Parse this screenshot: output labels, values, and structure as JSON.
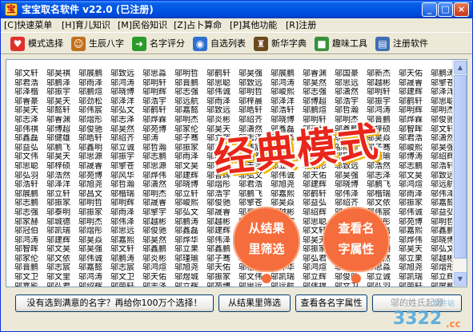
{
  "window": {
    "title": "宝宝取名软件 v22.0 (已注册)",
    "minimize_glyph": "_",
    "maximize_glyph": "□",
    "close_glyph": "×"
  },
  "menu": {
    "items": [
      {
        "label": "[C]快速菜单"
      },
      {
        "label": "[H]育儿知识"
      },
      {
        "label": "[M]民俗知识"
      },
      {
        "label": "[Z]占卜算命"
      },
      {
        "label": "[P]其他功能"
      },
      {
        "label": "[R]注册"
      }
    ]
  },
  "toolbar": {
    "items": [
      {
        "label": "模式选择",
        "icon": "heart-icon",
        "glyph": "♥",
        "color": "#e0302a"
      },
      {
        "label": "生辰八字",
        "icon": "people-icon",
        "glyph": "☺",
        "color": "#c0701a"
      },
      {
        "label": "名字评分",
        "icon": "arrow-right-icon",
        "glyph": "➜",
        "color": "#2a9a2a"
      },
      {
        "label": "自选列表",
        "icon": "globe-icon",
        "glyph": "◉",
        "color": "#2f6fd0"
      },
      {
        "label": "新华字典",
        "icon": "scholar-icon",
        "glyph": "♜",
        "color": "#6b4a1e"
      },
      {
        "label": "趣味工具",
        "icon": "windows-icon",
        "glyph": "■",
        "color": "#3a8f3a"
      },
      {
        "label": "注册软件",
        "icon": "register-icon",
        "glyph": "▤",
        "color": "#3f6fb5"
      }
    ]
  },
  "names": {
    "columns": [
      [
        "邬文轩",
        "邬君浩",
        "邬泽楷",
        "邬睿豪",
        "邬昊天",
        "邬志泽",
        "邬伟祺",
        "邬鑫磊",
        "邬益弘",
        "邬文伟",
        "邬思聪",
        "邬弘羽",
        "邬浩轩",
        "邬展鹏",
        "邬志鹏",
        "邬志强",
        "邬家赫",
        "邬冠伯",
        "邬鸿涛",
        "邬智晖",
        "邬家伦",
        "邬晋鹏",
        "邬文卫",
        "邬嘉影"
      ],
      [
        "邬昊褀",
        "邬鹏泽",
        "邬振宇",
        "邬昊天",
        "邬懿轩",
        "邬睿渊",
        "邬博超",
        "邬健雄",
        "邬鹏飞",
        "邬昊天",
        "邬梓硕",
        "邬浩然",
        "邬泽洋",
        "邬立轩",
        "邬振家",
        "邬泰明",
        "邬城德",
        "邬凯瑞",
        "邬建辉",
        "邬文昊",
        "邬文依",
        "邬志宸",
        "邬文里",
        "邬弘君"
      ],
      [
        "邬展鹏",
        "邬雨泽",
        "邬鹏煊",
        "邬劲松",
        "邬伟宸",
        "邬熠形",
        "邬俊驰",
        "邬皓轩",
        "邬鑫明",
        "邬思源",
        "邬晟睿",
        "邬苑博",
        "邬旭尧",
        "邬昌文",
        "邬明哲",
        "邬振家",
        "邬明杰",
        "邬熠彤",
        "邬昊焱",
        "邬昊强",
        "邬伟诚",
        "邬嘉懿",
        "邬鸿涛",
        "邬绍辉"
      ],
      [
        "邬致远",
        "邬鸿涛",
        "邬晓博",
        "邬泽洋",
        "邬弘文",
        "邬志泽",
        "邬昊然",
        "邬绍齐",
        "邬立诚",
        "邬振宇",
        "邬擎苍",
        "邬风华",
        "邬哲瀚",
        "邬楷瑞",
        "邬明辉",
        "邬雨泽",
        "邬伟泽",
        "邬思远",
        "邬嘉熙",
        "邬文轩",
        "邬鹏涛",
        "邬志宸",
        "邬文卫",
        "邬荣轩"
      ],
      [
        "邬思淼",
        "邬明轩",
        "邬明辉",
        "邬浩宇",
        "邬鹤轩",
        "邬烨霖",
        "邬苑博",
        "邬涛",
        "邬哲瀚",
        "邬志鹏",
        "邬思源",
        "邬烨伟",
        "邬潇然",
        "邬明杰",
        "邬晟睿",
        "邬擎宇",
        "邬越彬",
        "邬俊驰",
        "邬昊然",
        "邬鑫鹏",
        "邬炎彬",
        "邬鸿煊",
        "邬天佑",
        "邬志泽"
      ],
      [
        "邬明哲",
        "邬晋鹏",
        "邬志强",
        "邬远航",
        "邬嘉懿",
        "邬明杰",
        "邬家伦",
        "邬子骞",
        "邬振家",
        "邬雨泽",
        "邬文昊",
        "邬建辉",
        "邬晓博",
        "邬立轩",
        "邬峻熙",
        "邬弘文",
        "邬鹏涛",
        "邬鑫磊",
        "邬烨华",
        "邬立果",
        "邬瑾瑜",
        "邬旭尧",
        "邬煜城",
        "邬立辉"
      ],
      [
        "邬鹤轩",
        "邬思聪",
        "邬伟诚",
        "邬雨泽",
        "邬致远",
        "邬炎彬",
        "邬昊天",
        "邬立辉",
        "邬鸿涛",
        "邬展鹏",
        "邬博涛",
        "邬智辉",
        "邬熠彤",
        "邬浩宇",
        "邬俊驰",
        "邬晟睿",
        "邬越彬",
        "邬建辉",
        "邬伟泽",
        "邬鑫鹏",
        "邬子骞",
        "邬天佑",
        "邬振家",
        "邬苑博"
      ],
      [
        "邬昊强",
        "邬致远",
        "邬明哲",
        "邬梓晨",
        "邬皓轩",
        "邬绍齐",
        "邬潇然",
        "邬志泽",
        "邬伟宸",
        "邬浩然",
        "邬天宇",
        "邬弘文",
        "邬君浩",
        "邬鹏飞",
        "邬擎苍",
        "邬晋鹏",
        "邬嘉懿",
        "邬雨泽",
        "邬立果",
        "邬智晖",
        "邬烨伟",
        "邬楷瑞",
        "邬文伟",
        "邬思远"
      ],
      [
        "邬展鹏",
        "邬鸿涛",
        "邬峻熙",
        "邬泽洋",
        "邬浩轩",
        "邬晓博",
        "邬鑫磊",
        "邬思淼",
        "邬文昊",
        "邬明辉",
        "邬立诚",
        "邬伟诚",
        "邬旭尧",
        "邬嘉熙",
        "邬昊焱",
        "邬越彬",
        "邬振宇",
        "邬俊驰",
        "邬瑾瑜",
        "邬鹏涛",
        "邬志鹏",
        "邬烨华",
        "邬凯瑞",
        "邬远航"
      ],
      [
        "邬睿渊",
        "邬昊然",
        "邬志强",
        "邬博超",
        "邬鹏煊",
        "邬明轩",
        "邬苑博",
        "邬子骞",
        "邬泽楷",
        "邬晟睿",
        "邬熠形",
        "邬天佑",
        "邬建辉",
        "邬鹤轩",
        "邬益弘",
        "邬绍辉",
        "邬思聪",
        "邬文轩",
        "邬昊天",
        "邬振家",
        "邬弘君",
        "邬鸿煊",
        "邬立辉",
        "邬伟祺"
      ],
      [
        "邬国豪",
        "邬思远",
        "邬潇然",
        "邬浩宇",
        "邬哲瀚",
        "邬明杰",
        "邬鑫鹏",
        "邬炎彬",
        "邬雨泽",
        "邬家伦",
        "邬致远",
        "邬昊强",
        "邬晓博",
        "邬伟泽",
        "邬绍齐",
        "邬立轩",
        "邬擎宇",
        "邬明哲",
        "邬嘉懿",
        "邬展鹏",
        "邬皓轩",
        "邬城德",
        "邬俊驰",
        "邬文卫"
      ],
      [
        "邬新杰",
        "邬越彬",
        "邬明轩",
        "邬振宇",
        "邬鸿涛",
        "邬晋鹏",
        "邬梓硕",
        "邬昊焱",
        "邬子骞",
        "邬瑾瑜",
        "邬浩然",
        "邬志泽",
        "邬鹏飞",
        "邬楷瑞",
        "邬文依",
        "邬伟宸",
        "邬熠彤",
        "邬鑫磊",
        "邬天宇",
        "邬泰明",
        "邬昊然",
        "邬思淼",
        "邬立诚",
        "邬弘羽"
      ],
      [
        "邬天佑",
        "邬晟睿",
        "邬建辉",
        "邬鹤轩",
        "邬明辉",
        "邬烨霖",
        "邬智晖",
        "邬君浩",
        "邬峻熙",
        "邬博涛",
        "邬志鹏",
        "邬文昊",
        "邬鸿煊",
        "邬雨泽",
        "邬振家",
        "邬伟诚",
        "邬苑博",
        "邬嘉熙",
        "邬烨伟",
        "邬昊天",
        "邬立果",
        "邬旭尧",
        "邬凯瑞",
        "邬荣轩"
      ],
      [
        "邬鹏涛",
        "邬擎苍",
        "邬泽洋",
        "邬思聪",
        "邬明杰",
        "邬俊驰",
        "邬文轩",
        "邬潇然",
        "邬昊强",
        "邬绍辉",
        "邬浩轩",
        "邬致远",
        "邬远航",
        "邬伟泽",
        "邬嘉懿",
        "邬益弘",
        "邬明哲",
        "邬鑫鹏",
        "邬晓博",
        "邬弘文",
        "邬越彬",
        "邬熠形",
        "邬立辉",
        "邬展鹏"
      ]
    ]
  },
  "overlay": {
    "banner": "经典模式",
    "cloud_left": [
      "从结果",
      "里筛选"
    ],
    "cloud_right": [
      "查看名",
      "字属性"
    ]
  },
  "bottom_buttons": {
    "retry": "没有选到满意的名字？再给你100万个选择！",
    "filter": "从结果里筛选",
    "attrs": "查看各名字属性",
    "disabled": "邬的姓氏起源"
  },
  "watermark": {
    "logo": "3322",
    "site": "软件站",
    "cc": ".cc"
  }
}
